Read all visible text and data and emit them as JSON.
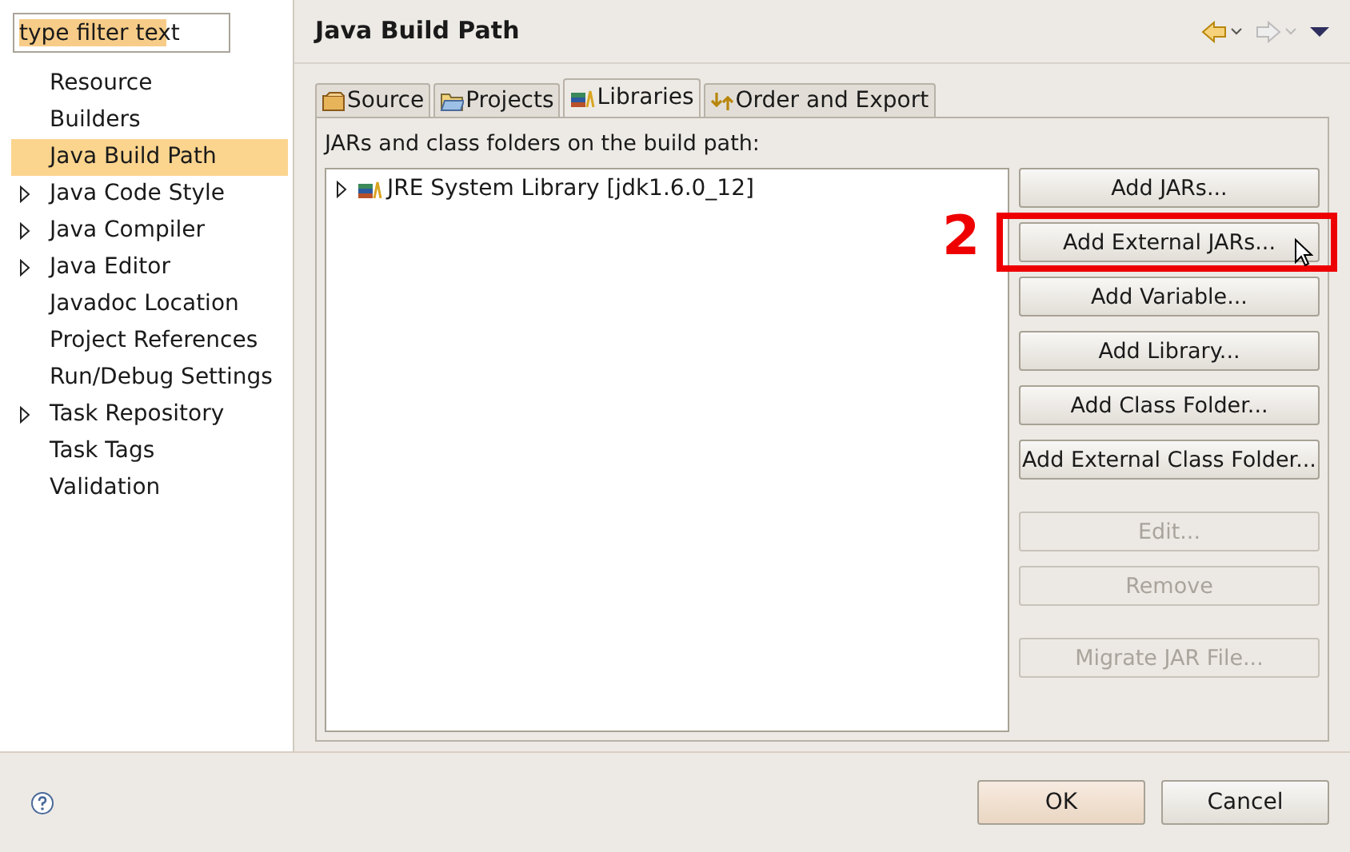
{
  "filter": {
    "value": "type filter text"
  },
  "nav": [
    {
      "label": "Resource",
      "expandable": false,
      "selected": false
    },
    {
      "label": "Builders",
      "expandable": false,
      "selected": false
    },
    {
      "label": "Java Build Path",
      "expandable": false,
      "selected": true
    },
    {
      "label": "Java Code Style",
      "expandable": true,
      "selected": false
    },
    {
      "label": "Java Compiler",
      "expandable": true,
      "selected": false
    },
    {
      "label": "Java Editor",
      "expandable": true,
      "selected": false
    },
    {
      "label": "Javadoc Location",
      "expandable": false,
      "selected": false
    },
    {
      "label": "Project References",
      "expandable": false,
      "selected": false
    },
    {
      "label": "Run/Debug Settings",
      "expandable": false,
      "selected": false
    },
    {
      "label": "Task Repository",
      "expandable": true,
      "selected": false
    },
    {
      "label": "Task Tags",
      "expandable": false,
      "selected": false
    },
    {
      "label": "Validation",
      "expandable": false,
      "selected": false
    }
  ],
  "page_title": "Java Build Path",
  "tabs": [
    {
      "label": "Source",
      "kind": "source",
      "selected": false
    },
    {
      "label": "Projects",
      "kind": "projects",
      "selected": false
    },
    {
      "label": "Libraries",
      "kind": "libraries",
      "selected": true
    },
    {
      "label": "Order and Export",
      "kind": "order",
      "selected": false
    }
  ],
  "list_label": "JARs and class folders on the build path:",
  "tree": [
    {
      "label": "JRE System Library [jdk1.6.0_12]",
      "expanded": false
    }
  ],
  "annotation": "2",
  "button_groups": [
    [
      {
        "label": "Add JARs...",
        "disabled": false,
        "highlighted": false
      },
      {
        "label": "Add External JARs...",
        "disabled": false,
        "highlighted": true
      },
      {
        "label": "Add Variable...",
        "disabled": false,
        "highlighted": false
      },
      {
        "label": "Add Library...",
        "disabled": false,
        "highlighted": false
      },
      {
        "label": "Add Class Folder...",
        "disabled": false,
        "highlighted": false
      },
      {
        "label": "Add External Class Folder...",
        "disabled": false,
        "highlighted": false
      }
    ],
    [
      {
        "label": "Edit...",
        "disabled": true,
        "highlighted": false
      },
      {
        "label": "Remove",
        "disabled": true,
        "highlighted": false
      }
    ],
    [
      {
        "label": "Migrate JAR File...",
        "disabled": true,
        "highlighted": false
      }
    ]
  ],
  "footer": [
    {
      "label": "OK",
      "kind": "default"
    },
    {
      "label": "Cancel",
      "kind": "normal"
    }
  ]
}
